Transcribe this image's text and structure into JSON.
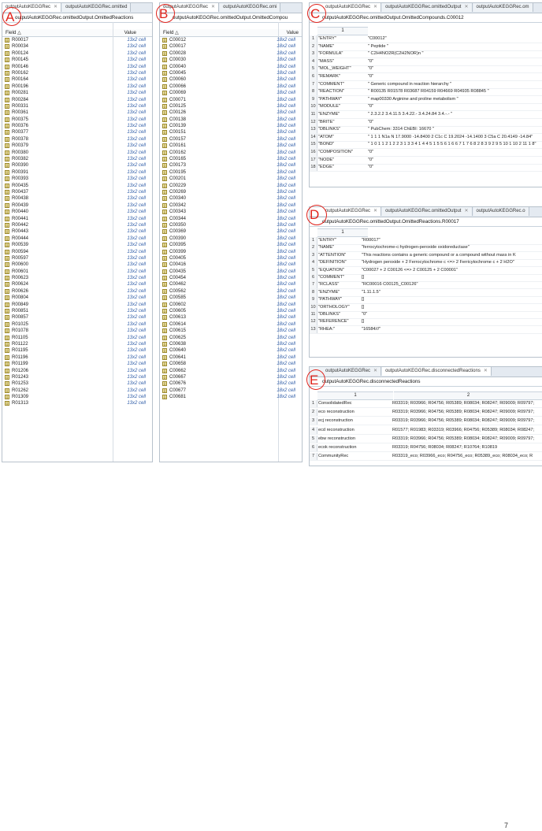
{
  "markers": [
    "A",
    "B",
    "C",
    "D",
    "E"
  ],
  "panel_a": {
    "tabs": [
      "outputAutoKEGGRec",
      "outputAutoKEGGRec.omitted"
    ],
    "title": "outputAutoKEGGRec.omittedOutput.OmittedReactions",
    "header_field": "Field △",
    "header_value": "Value",
    "value_text": "13x2 cell",
    "rows": [
      "R00017",
      "R00034",
      "R00124",
      "R00145",
      "R00146",
      "R00162",
      "R00164",
      "R00196",
      "R00281",
      "R00284",
      "R00331",
      "R00361",
      "R00375",
      "R00376",
      "R00377",
      "R00378",
      "R00379",
      "R00380",
      "R00382",
      "R00390",
      "R00391",
      "R00393",
      "R00435",
      "R00437",
      "R00438",
      "R00439",
      "R00440",
      "R00441",
      "R00442",
      "R00443",
      "R00444",
      "R00539",
      "R00594",
      "R00597",
      "R00600",
      "R00601",
      "R00623",
      "R00624",
      "R00626",
      "R00804",
      "R00849",
      "R00851",
      "R00857",
      "R01025",
      "R01078",
      "R01105",
      "R01122",
      "R01195",
      "R01196",
      "R01199",
      "R01206",
      "R01243",
      "R01253",
      "R01262",
      "R01309",
      "R01313"
    ]
  },
  "panel_b": {
    "tabs": [
      "outputAutoKEGGRec",
      "outputAutoKEGGRec.omi"
    ],
    "title": "outputAutoKEGGRec.omittedOutput.OmittedCompou",
    "header_field": "Field △",
    "header_value": "Value",
    "value_text": "18x2 cell",
    "rows": [
      "C00012",
      "C00017",
      "C00028",
      "C00030",
      "C00040",
      "C00045",
      "C00060",
      "C00066",
      "C00069",
      "C00071",
      "C00125",
      "C00126",
      "C00138",
      "C00139",
      "C00151",
      "C00157",
      "C00161",
      "C00162",
      "C00165",
      "C00173",
      "C00195",
      "C00201",
      "C00229",
      "C00269",
      "C00340",
      "C00342",
      "C00343",
      "C00344",
      "C00350",
      "C00369",
      "C00390",
      "C00395",
      "C00399",
      "C00405",
      "C00416",
      "C00435",
      "C00454",
      "C00462",
      "C00562",
      "C00585",
      "C00602",
      "C00605",
      "C00613",
      "C00614",
      "C00615",
      "C00625",
      "C00638",
      "C00640",
      "C00641",
      "C00658",
      "C00662",
      "C00667",
      "C00676",
      "C00677",
      "C00681"
    ]
  },
  "panel_c": {
    "tabs": [
      "outputAutoKEGGRec",
      "outputAutoKEGGRec.omittedOutput",
      "outputAutoKEGGRec.om"
    ],
    "title": "outputAutoKEGGRec.omittedOutput.OmittedCompounds.C00012",
    "col_header": "1",
    "rows": [
      {
        "n": "1",
        "k": "\"ENTRY\"",
        "v": "\"C00012\""
      },
      {
        "n": "2",
        "k": "\"NAME\"",
        "v": "\" Peptide \""
      },
      {
        "n": "3",
        "k": "\"FORMULA\"",
        "v": "\" C2H4NO2R(C2H2NOR)n \""
      },
      {
        "n": "4",
        "k": "\"MASS\"",
        "v": "\"0\""
      },
      {
        "n": "5",
        "k": "\"MOL_WEIGHT\"",
        "v": "\"0\""
      },
      {
        "n": "6",
        "k": "\"REMARK\"",
        "v": "\"0\""
      },
      {
        "n": "7",
        "k": "\"COMMENT\"",
        "v": "\" Generic compound in reaction hierarchy \""
      },
      {
        "n": "8",
        "k": "\"REACTION\"",
        "v": "\" R00135 R01578 R03687 R04159 R04669 R04935 R08845 \""
      },
      {
        "n": "9",
        "k": "\"PATHWAY\"",
        "v": "\" map00330 Arginine and proline metabolism \""
      },
      {
        "n": "10",
        "k": "\"MODULE\"",
        "v": "\"0\""
      },
      {
        "n": "11",
        "k": "\"ENZYME\"",
        "v": "\" 2.3.2.2 3.4.11.5 3.4.22.- 3.4.24.84 3.4.-.- \""
      },
      {
        "n": "12",
        "k": "\"BRITE\"",
        "v": "\"0\""
      },
      {
        "n": "13",
        "k": "\"DBLINKS\"",
        "v": "\" PubChem: 3314 ChEBI: 16670 \""
      },
      {
        "n": "14",
        "k": "\"ATOM\"",
        "v": "\" 1 1 1 N1a N 17.9000 -14.8400 2 C1c C 19.2024 -14.1400 3 C5a C 20.4149 -14.84\""
      },
      {
        "n": "15",
        "k": "\"BOND\"",
        "v": "\" 1 0 1 1 2 1 2 2 3 1 3 3 4 1 4 4 5 1 5 5 6 1 6 6 7 1 7 6 8 2 8 3 9 2 9 5 10 1 10 2 11 1 8\""
      },
      {
        "n": "16",
        "k": "\"COMPOSITION\"",
        "v": "\"0\""
      },
      {
        "n": "17",
        "k": "\"NODE\"",
        "v": "\"0\""
      },
      {
        "n": "18",
        "k": "\"EDGE\"",
        "v": "\"0\""
      }
    ]
  },
  "panel_d": {
    "tabs": [
      "outputAutoKEGGRec",
      "outputAutoKEGGRec.omittedOutput",
      "outputAutoKEGGRec.o"
    ],
    "title": "outputAutoKEGGRec.omittedOutput.OmittedReactions.R00017",
    "col_header": "1",
    "rows": [
      {
        "n": "1",
        "k": "\"ENTRY\"",
        "v": "\"R00017\""
      },
      {
        "n": "2",
        "k": "\"NAME\"",
        "v": "\"ferrocytochrome-c:hydrogen-peroxide oxidoreductase\""
      },
      {
        "n": "3",
        "k": "\"ATTENTION\"",
        "v": "\"This reactions contains a generic compound or a compound without mass in K"
      },
      {
        "n": "4",
        "k": "\"DEFINITION\"",
        "v": "\"Hydrogen peroxide + 2 Ferrocytochrome c <=> 2 Ferricytochrome c + 2 H2O\""
      },
      {
        "n": "5",
        "k": "\"EQUATION\"",
        "v": "\"C00027 + 2 C00126 <=> 2 C00125 + 2 C00001\""
      },
      {
        "n": "6",
        "k": "\"COMMENT\"",
        "v": "[]"
      },
      {
        "n": "7",
        "k": "\"RCLASS\"",
        "v": "\"RC00016 C00125_C00126\""
      },
      {
        "n": "8",
        "k": "\"ENZYME\"",
        "v": "\"1.11.1.5\""
      },
      {
        "n": "9",
        "k": "\"PATHWAY\"",
        "v": "[]"
      },
      {
        "n": "10",
        "k": "\"ORTHOLOGY\"",
        "v": "[]"
      },
      {
        "n": "11",
        "k": "\"DBLINKS\"",
        "v": "\"0\""
      },
      {
        "n": "12",
        "k": "\"REFERENCE\"",
        "v": "[]"
      },
      {
        "n": "13",
        "k": "\"RHEA:\"",
        "v": "\"16584///\""
      }
    ]
  },
  "panel_e": {
    "tabs": [
      "outputAutoKEGGRec",
      "outputAutoKEGGRec.disconnectedReactions"
    ],
    "title": "outputAutoKEGGRec.disconnectedReactions",
    "col1_header": "1",
    "col2_header": "2",
    "rows": [
      {
        "n": "1",
        "k": "ConsolidatedRec",
        "v": "R03319; R03966; R04756; R05389; R08034; R08247; R09009; R09797;"
      },
      {
        "n": "2",
        "k": "eco reconstruction",
        "v": "R03319; R03966; R04756; R05389; R08034; R08247; R09009; R09797;"
      },
      {
        "n": "3",
        "k": "ecj reconstruction",
        "v": "R03319; R03966; R04756; R05389; R08034; R08247; R09009; R09797;"
      },
      {
        "n": "4",
        "k": "ecd reconstruction",
        "v": "R01577; R01983; R03319; R03966; R04756; R05389; R08034; R08247;"
      },
      {
        "n": "5",
        "k": "ebw reconstruction",
        "v": "R03319; R03966; R04756; R05389; R08034; R08247; R09009; R09797;"
      },
      {
        "n": "6",
        "k": "ecok reconstruction",
        "v": "R03319; R04756; R08034; R08247; R10764; R10819"
      },
      {
        "n": "7",
        "k": "CommunityRec",
        "v": "R03319_eco; R03966_eco; R04756_eco; R05389_eco; R08034_eco; R"
      }
    ]
  },
  "page_number": "7"
}
